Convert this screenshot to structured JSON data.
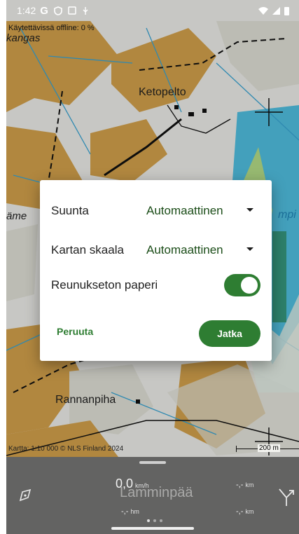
{
  "status_bar": {
    "time": "1:42",
    "icons_left": [
      "google-g-icon",
      "shield-icon",
      "screen-icon",
      "usb-icon"
    ],
    "icons_right": [
      "wifi-icon",
      "signal-icon",
      "battery-icon"
    ]
  },
  "map": {
    "offline_label": "Käytettävissä offline: 0 %",
    "place_names": {
      "kangas": "kangas",
      "ketopelto": "Ketopelto",
      "rannanpiha": "Rannanpiha",
      "left_edge": "äme",
      "right_edge": "mpi"
    },
    "attribution": "Kartta: 1:10 000 © NLS Finland 2024",
    "scale_bar": "200 m",
    "colors": {
      "field": "#d8a54e",
      "open_land": "#e8e8e0",
      "water": "#52c4e6",
      "forest": "#ffffff",
      "marsh": "#2e8b57"
    }
  },
  "dialog": {
    "rows": [
      {
        "label": "Suunta",
        "value": "Automaattinen"
      },
      {
        "label": "Kartan skaala",
        "value": "Automaattinen"
      },
      {
        "label": "Reunukseton paperi",
        "toggle_on": true
      }
    ],
    "cancel_label": "Peruuta",
    "continue_label": "Jatka",
    "accent_color": "#2e7d32"
  },
  "bottom_panel": {
    "speed": "0,0",
    "speed_unit": "km/h",
    "location_name": "Lamminpää",
    "left_value": "-,-",
    "left_unit": "hm",
    "right_top_value": "-,-",
    "right_top_unit": "km",
    "right_bottom_value": "-,-",
    "right_bottom_unit": "km",
    "left_icon": "compass-icon",
    "right_icon": "route-direction-icon"
  }
}
